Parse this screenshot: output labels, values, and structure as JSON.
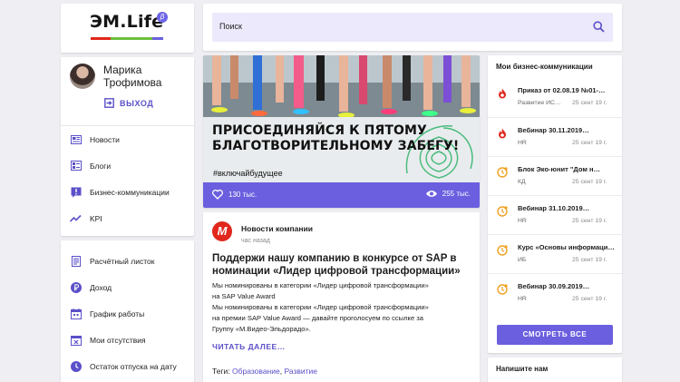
{
  "logo": {
    "text": "ЭМ.Life",
    "badge": "β",
    "bar_colors": [
      "#e1271c",
      "#6bbf3b",
      "#6b5fdf"
    ]
  },
  "user": {
    "name": "Марика Трофимова",
    "logout_label": "ВЫХОД"
  },
  "menu": [
    {
      "label": "Новости",
      "icon": "news-icon"
    },
    {
      "label": "Блоги",
      "icon": "blog-icon"
    },
    {
      "label": "Бизнес-коммуникации",
      "icon": "alert-icon"
    },
    {
      "label": "KPI",
      "icon": "trend-icon"
    }
  ],
  "tools": [
    {
      "label": "Расчётный листок",
      "icon": "document-icon"
    },
    {
      "label": "Доход",
      "icon": "ruble-icon"
    },
    {
      "label": "График работы",
      "icon": "calendar-icon"
    },
    {
      "label": "Мои отсутствия",
      "icon": "calendar-cross-icon"
    },
    {
      "label": "Остаток отпуска на дату",
      "icon": "clock-icon"
    }
  ],
  "search": {
    "placeholder": "Поиск"
  },
  "banner": {
    "headline_line1": "ПРИСОЕДИНЯЙСЯ К ПЯТОМУ",
    "headline_line2": "БЛАГОТВОРИТЕЛЬНОМУ ЗАБЕГУ!",
    "hashtag": "#включайбудущее",
    "likes": "130 тыс.",
    "views": "255 тыс."
  },
  "news": {
    "source": "Новости компании",
    "time": "час назад",
    "title": "Поддержи нашу компанию в конкурсе от SAP в номинации «Лидер цифровой трансформации»",
    "body_line1": "Мы номинированы в категории «Лидер цифровой трансформации»",
    "body_line2": "на SAP Value Award",
    "body_line3": "Мы номинированы в категории «Лидер цифровой трансформации»",
    "body_line4": "на премии SAP Value Award — давайте проголосуем по ссылке за",
    "body_line5": "Группу «М.Видео-Эльдорадо».",
    "read_more": "ЧИТАТЬ ДАЛЕЕ…",
    "tags_label": "Теги:",
    "tag1": "Образование",
    "tag_sep": ",",
    "tag2": "Развитие"
  },
  "biz": {
    "title": "Мои бизнес-коммуникации",
    "items": [
      {
        "name": "Приказ от 02.08.19 №01-…",
        "dept": "Развитие ИС…",
        "date": "25 сент 19 г.",
        "icon": "fire-icon",
        "color": "#e1271c"
      },
      {
        "name": "Вебинар 30.11.2019…",
        "dept": "HR",
        "date": "25 сент 19 г.",
        "icon": "fire-icon",
        "color": "#e1271c"
      },
      {
        "name": "Блок Эко-юнит \"Дом н…",
        "dept": "КД",
        "date": "25 сент 19 г.",
        "icon": "clock-alert-icon",
        "color": "#f0a020"
      },
      {
        "name": "Вебинар 31.10.2019…",
        "dept": "HR",
        "date": "25 сент 19 г.",
        "icon": "clock-alert-icon",
        "color": "#f0a020"
      },
      {
        "name": "Курс «Основы информаци…",
        "dept": "ИБ",
        "date": "25 сент 19 г.",
        "icon": "clock-alert-icon",
        "color": "#f0a020"
      },
      {
        "name": "Вебинар 30.09.2019…",
        "dept": "HR",
        "date": "25 сент 19 г.",
        "icon": "clock-alert-icon",
        "color": "#f0a020"
      }
    ],
    "button": "СМОТРЕТЬ ВСЕ"
  },
  "write": {
    "title": "Напишите нам"
  },
  "colors": {
    "accent": "#6b5fdf",
    "brand_red": "#e1271c"
  }
}
